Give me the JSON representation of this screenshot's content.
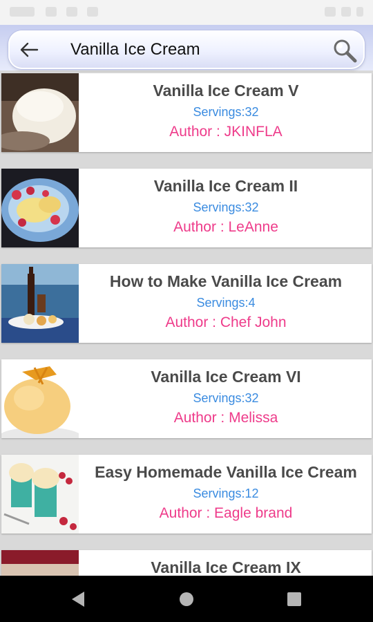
{
  "search": {
    "query": "Vanilla Ice Cream"
  },
  "recipes": [
    {
      "title": "Vanilla Ice Cream V",
      "servings": "Servings:32",
      "author": "Author : JKINFLA"
    },
    {
      "title": "Vanilla Ice Cream II",
      "servings": "Servings:32",
      "author": "Author : LeAnne"
    },
    {
      "title": "How to Make Vanilla Ice Cream",
      "servings": "Servings:4",
      "author": "Author : Chef John"
    },
    {
      "title": "Vanilla Ice Cream VI",
      "servings": "Servings:32",
      "author": "Author : Melissa"
    },
    {
      "title": "Easy Homemade Vanilla Ice Cream",
      "servings": "Servings:12",
      "author": "Author : Eagle brand"
    },
    {
      "title": "Vanilla Ice Cream IX",
      "servings": "",
      "author": ""
    }
  ],
  "icons": {
    "back": "arrow-left-icon",
    "search": "magnifier-icon",
    "nav_back": "triangle-back-icon",
    "nav_home": "circle-home-icon",
    "nav_recents": "square-recents-icon"
  },
  "colors": {
    "title": "#4a4a4a",
    "servings": "#3a8be0",
    "author": "#ee3b8a",
    "search_bar": "#eef1ff"
  }
}
